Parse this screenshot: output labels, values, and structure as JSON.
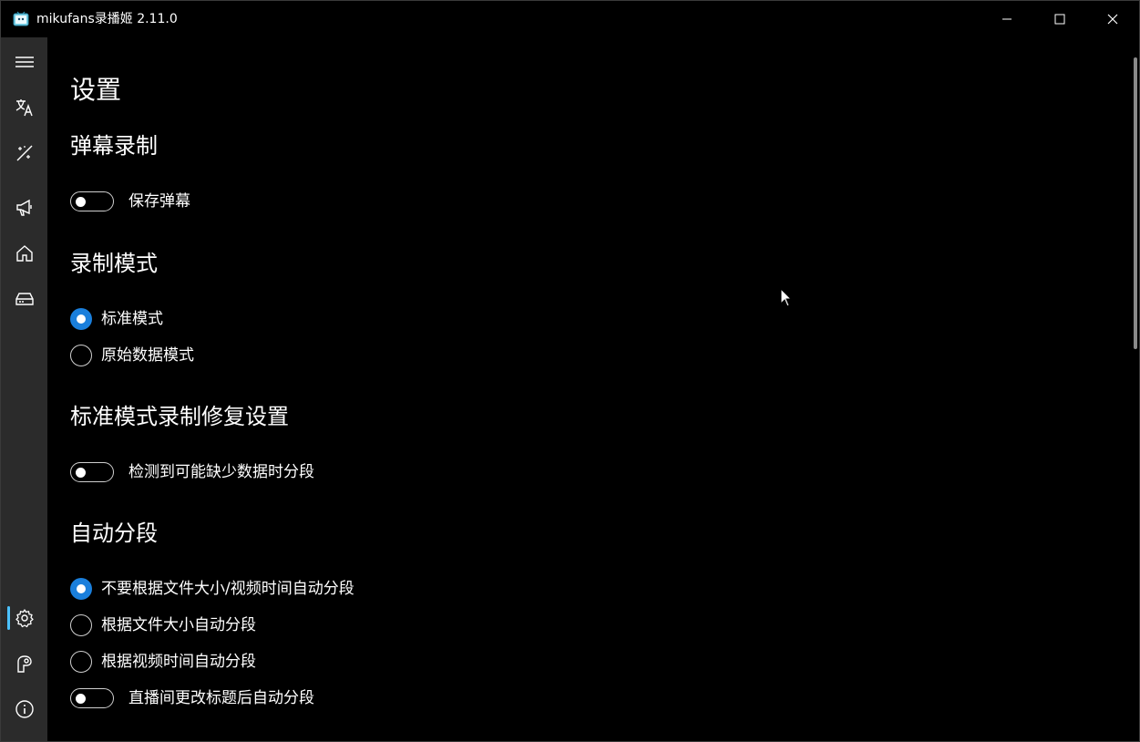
{
  "window": {
    "title": "mikufans录播姬 2.11.0"
  },
  "nav": {
    "items": [
      {
        "icon": "hamburger-menu-icon"
      },
      {
        "icon": "translate-icon"
      },
      {
        "icon": "magic-wand-icon"
      },
      {
        "icon": "megaphone-icon"
      },
      {
        "icon": "home-icon"
      },
      {
        "icon": "storage-icon"
      }
    ],
    "bottom_items": [
      {
        "icon": "settings-icon",
        "active": true
      },
      {
        "icon": "toolbox-icon"
      },
      {
        "icon": "info-icon"
      }
    ],
    "accent_color": "#4cc2ff"
  },
  "page": {
    "title": "设置"
  },
  "danmaku": {
    "title": "弹幕录制",
    "save_danmaku_label": "保存弹幕",
    "save_danmaku_on": false
  },
  "record_mode": {
    "title": "录制模式",
    "options": [
      {
        "label": "标准模式",
        "checked": true
      },
      {
        "label": "原始数据模式",
        "checked": false
      }
    ]
  },
  "fix_settings": {
    "title": "标准模式录制修复设置",
    "split_on_missing_label": "检测到可能缺少数据时分段",
    "split_on_missing_on": false
  },
  "auto_split": {
    "title": "自动分段",
    "options": [
      {
        "label": "不要根据文件大小/视频时间自动分段",
        "checked": true
      },
      {
        "label": "根据文件大小自动分段",
        "checked": false
      },
      {
        "label": "根据视频时间自动分段",
        "checked": false
      }
    ],
    "split_on_title_change_label": "直播间更改标题后自动分段",
    "split_on_title_change_on": false
  },
  "colors": {
    "radio_checked": "#1a7fdc",
    "background": "#000000",
    "nav_background": "#2b2b2b"
  }
}
